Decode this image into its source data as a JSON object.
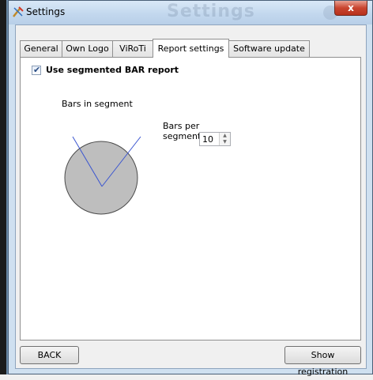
{
  "window": {
    "title": "Settings",
    "ghost_title": "Settings",
    "close_symbol": "x"
  },
  "tabs": [
    {
      "label": "General",
      "active": false
    },
    {
      "label": "Own Logo",
      "active": false
    },
    {
      "label": "ViRoTi",
      "active": false
    },
    {
      "label": "Report settings",
      "active": true
    },
    {
      "label": "Software update",
      "active": false
    }
  ],
  "report": {
    "use_segmented_label": "Use segmented BAR report",
    "use_segmented_checked": true,
    "check_mark": "✔",
    "diagram_label": "Bars in segment",
    "bars_per_segment_line1": "Bars per",
    "bars_per_segment_line2": "segment",
    "bars_per_segment_value": "10"
  },
  "footer": {
    "back_label": "BACK",
    "show_registration_label": "Show registration"
  },
  "colors": {
    "circle_fill": "#bebebe",
    "line_color": "#3a55d0",
    "close_red": "#c9452f"
  },
  "icons": {
    "app": "settings-app-icon",
    "spin_up": "spin-up-arrow-icon",
    "spin_down": "spin-down-arrow-icon"
  }
}
